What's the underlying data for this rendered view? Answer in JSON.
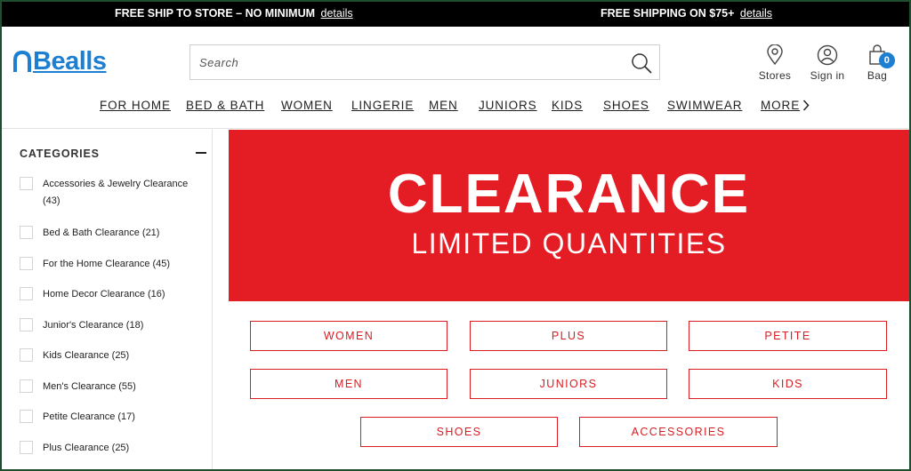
{
  "promo": {
    "left_text": "FREE SHIP TO STORE – NO MINIMUM",
    "left_link": "details",
    "right_text": "FREE SHIPPING ON $75+",
    "right_link": "details"
  },
  "header": {
    "logo_text": "Bealls",
    "search_placeholder": "Search",
    "stores_label": "Stores",
    "signin_label": "Sign in",
    "bag_label": "Bag",
    "bag_count": "0"
  },
  "nav": {
    "items": [
      "FOR HOME",
      "BED & BATH",
      "WOMEN",
      "LINGERIE",
      "MEN",
      "JUNIORS",
      "KIDS",
      "SHOES",
      "SWIMWEAR",
      "MORE"
    ]
  },
  "sidebar": {
    "header": "CATEGORIES",
    "items": [
      "Accessories & Jewelry Clearance (43)",
      "Bed & Bath Clearance (21)",
      "For the Home Clearance (45)",
      "Home Decor Clearance (16)",
      "Junior's Clearance (18)",
      "Kids Clearance (25)",
      "Men's Clearance (55)",
      "Petite Clearance (17)",
      "Plus Clearance (25)"
    ]
  },
  "banner": {
    "title": "CLEARANCE",
    "subtitle": "LIMITED QUANTITIES"
  },
  "category_buttons": [
    "WOMEN",
    "PLUS",
    "PETITE",
    "MEN",
    "JUNIORS",
    "KIDS",
    "SHOES",
    "ACCESSORIES"
  ],
  "colors": {
    "brand_blue": "#1d7fd1",
    "clearance_red": "#e41c24",
    "promo_bar": "#000000"
  }
}
